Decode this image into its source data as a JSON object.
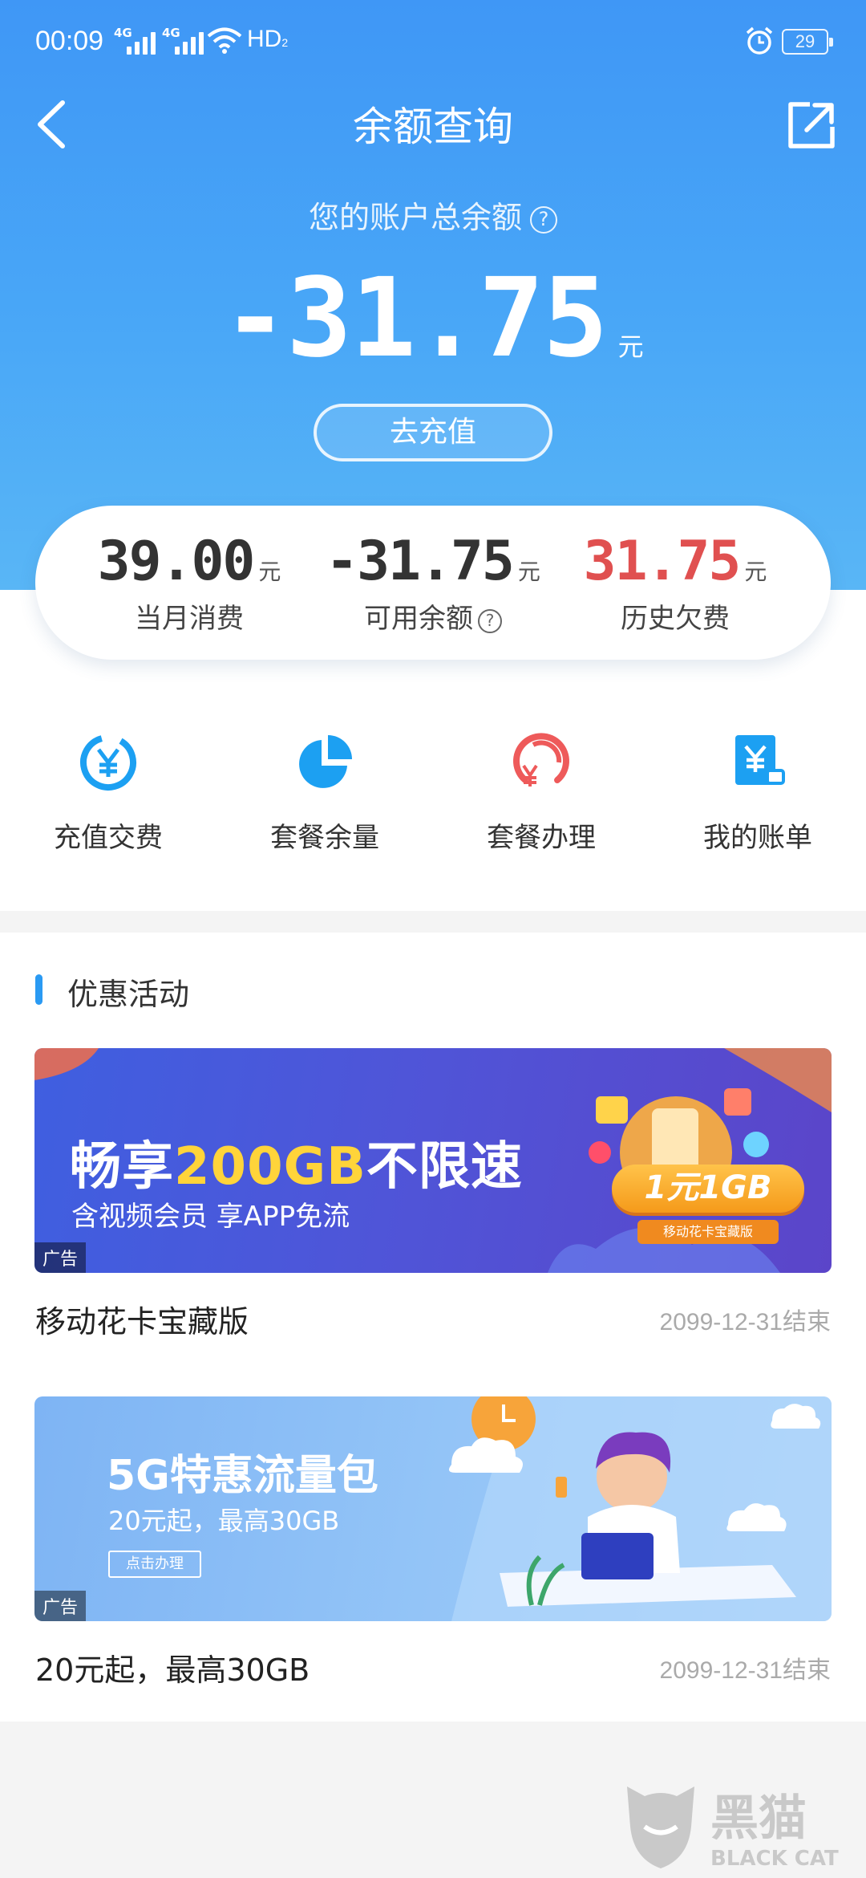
{
  "status_bar": {
    "time": "00:09",
    "network_1": "4G",
    "network_2": "4G",
    "hd": "HD",
    "hd_sub": "2",
    "battery": "29"
  },
  "nav": {
    "title": "余额查询",
    "back_icon": "chevron-left-icon",
    "share_icon": "share-external-icon"
  },
  "balance": {
    "label": "您的账户总余额",
    "help_icon": "?",
    "amount": "-31.75",
    "unit": "元",
    "recharge_button": "去充值"
  },
  "summary": [
    {
      "value": "39.00",
      "unit": "元",
      "label": "当月消费",
      "color": "#333333"
    },
    {
      "value": "-31.75",
      "unit": "元",
      "label": "可用余额",
      "help": "?",
      "color": "#333333"
    },
    {
      "value": "31.75",
      "unit": "元",
      "label": "历史欠费",
      "color": "#e05050"
    }
  ],
  "quick_actions": [
    {
      "label": "充值交费",
      "icon": "yen-refresh-icon"
    },
    {
      "label": "套餐余量",
      "icon": "pie-chart-icon"
    },
    {
      "label": "套餐办理",
      "icon": "yen-cycle-icon"
    },
    {
      "label": "我的账单",
      "icon": "bill-icon"
    }
  ],
  "promotions": {
    "section_title": "优惠活动",
    "items": [
      {
        "banner_prefix": "畅享",
        "banner_highlight": "200GB",
        "banner_suffix": "不限速",
        "banner_sub": "含视频会员 享APP免流",
        "badge": "1元1GB",
        "badge_sub": "移动花卡宝藏版",
        "ad_tag": "广告",
        "name": "移动花卡宝藏版",
        "end_date": "2099-12-31结束"
      },
      {
        "banner_title": "5G特惠流量包",
        "banner_sub": "20元起，最高30GB",
        "banner_button": "点击办理",
        "ad_tag": "广告",
        "name": "20元起，最高30GB",
        "end_date": "2099-12-31结束"
      }
    ]
  },
  "watermark": {
    "brand": "黑猫",
    "brand_en": "BLACK CAT"
  },
  "colors": {
    "primary": "#3f97f6",
    "accent_red": "#e05050",
    "section_bar": "#2a9af3"
  }
}
